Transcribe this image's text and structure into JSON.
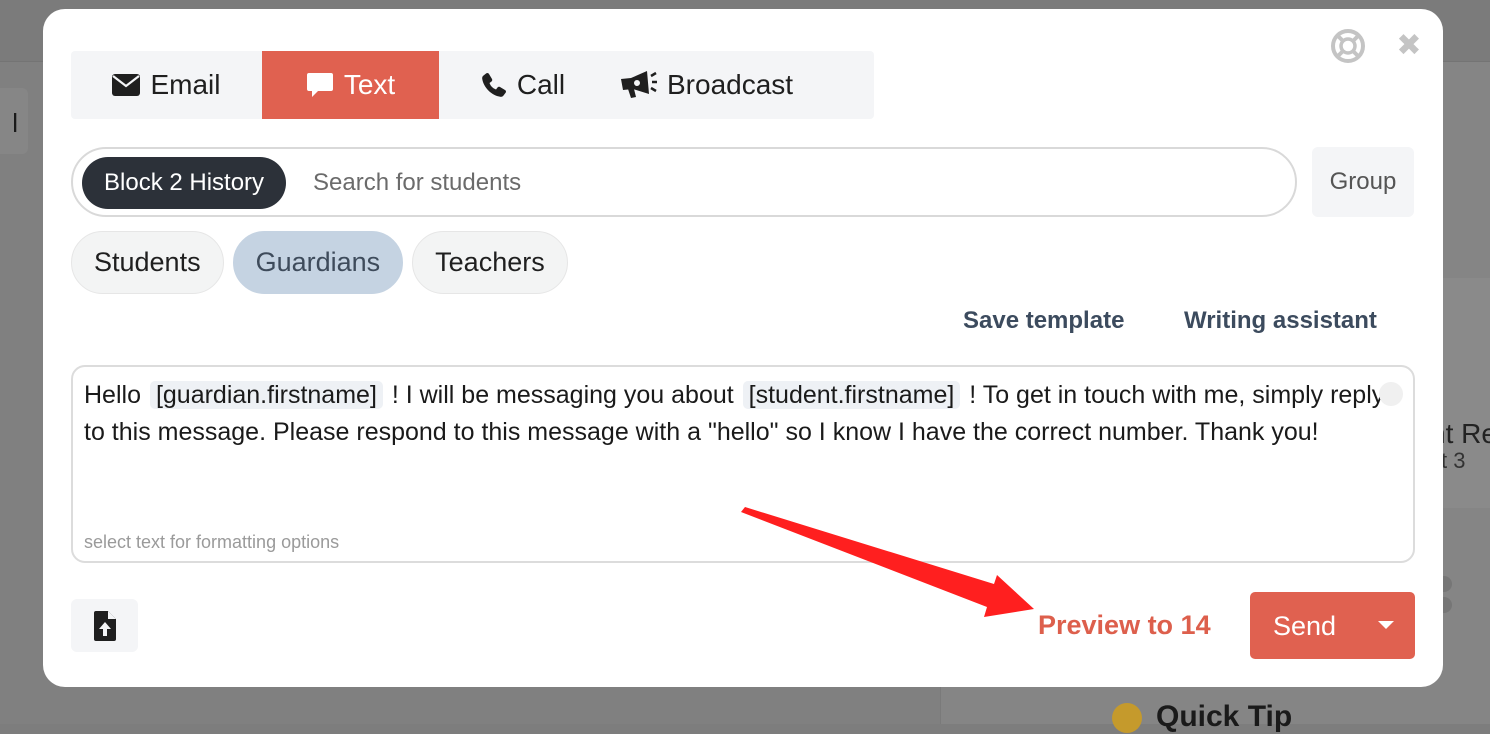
{
  "background": {
    "partial_text_right": "nt Re",
    "partial_subtext_right": "st 3",
    "quick_tip": "Quick Tip",
    "left_partial": "l"
  },
  "modal": {
    "tabs": [
      {
        "label": "Email",
        "icon": "envelope-icon"
      },
      {
        "label": "Text",
        "icon": "chat-bubble-icon",
        "active": true
      },
      {
        "label": "Call",
        "icon": "phone-icon"
      },
      {
        "label": "Broadcast",
        "icon": "megaphone-icon"
      }
    ],
    "recipient": {
      "chip_label": "Block 2 History",
      "search_placeholder": "Search for students"
    },
    "group_label": "Group",
    "audience": [
      {
        "label": "Students",
        "active": false
      },
      {
        "label": "Guardians",
        "active": true
      },
      {
        "label": "Teachers",
        "active": false
      }
    ],
    "actions": {
      "save_template": "Save template",
      "writing_assistant": "Writing assistant"
    },
    "message": {
      "part1": "Hello",
      "token1": "[guardian.firstname]",
      "part2": "! I will be messaging you about",
      "token2": "[student.firstname]",
      "part3": "! To get in touch with me, simply reply to this message. Please respond to this message with a \"hello\" so I know I have the correct number. Thank you!",
      "hint": "select text for formatting options"
    },
    "footer": {
      "preview_label": "Preview to 14",
      "send_label": "Send"
    }
  },
  "colors": {
    "accent": "#e06150",
    "active_audience": "#c5d3e2",
    "chip_dark": "#2c3139",
    "annotation_arrow": "#ff1f1f"
  }
}
